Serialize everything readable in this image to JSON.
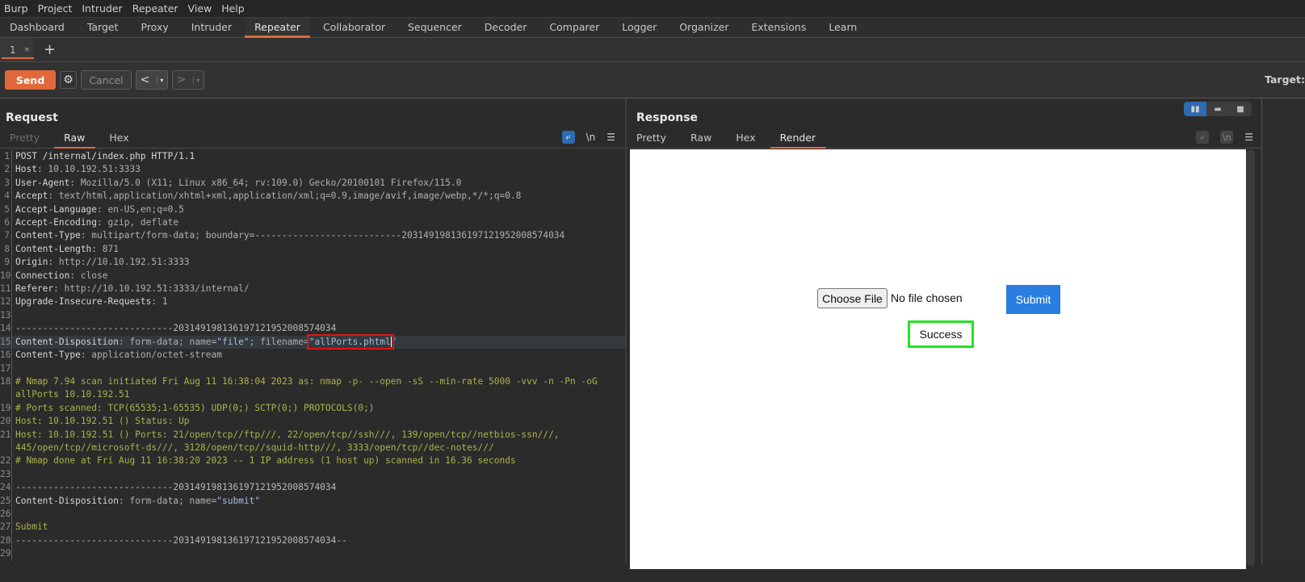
{
  "menubar": [
    "Burp",
    "Project",
    "Intruder",
    "Repeater",
    "View",
    "Help"
  ],
  "main_tabs": [
    {
      "label": "Dashboard"
    },
    {
      "label": "Target"
    },
    {
      "label": "Proxy"
    },
    {
      "label": "Intruder"
    },
    {
      "label": "Repeater",
      "active": true
    },
    {
      "label": "Collaborator"
    },
    {
      "label": "Sequencer"
    },
    {
      "label": "Decoder"
    },
    {
      "label": "Comparer"
    },
    {
      "label": "Logger"
    },
    {
      "label": "Organizer"
    },
    {
      "label": "Extensions"
    },
    {
      "label": "Learn"
    }
  ],
  "repeater_tab": {
    "label": "1",
    "close": "×",
    "add": "+"
  },
  "toolbar": {
    "send": "Send",
    "cancel": "Cancel",
    "prev": "<",
    "next": ">",
    "dropdown": "▾",
    "target_label": "Target:"
  },
  "request": {
    "title": "Request",
    "tabs": [
      "Pretty",
      "Raw",
      "Hex"
    ],
    "active_tab": "Raw",
    "tools": {
      "wrap": "wrap-icon",
      "newline": "\\n",
      "menu": "☰"
    },
    "lines": [
      {
        "n": "1",
        "parts": [
          [
            "code",
            "POST /internal/index.php HTTP/1.1"
          ]
        ]
      },
      {
        "n": "2",
        "parts": [
          [
            "hn",
            "Host"
          ],
          [
            "hv",
            ": 10.10.192.51:3333"
          ]
        ]
      },
      {
        "n": "3",
        "parts": [
          [
            "hn",
            "User-Agent"
          ],
          [
            "hv",
            ": Mozilla/5.0 (X11; Linux x86_64; rv:109.0) Gecko/20100101 Firefox/115.0"
          ]
        ]
      },
      {
        "n": "4",
        "parts": [
          [
            "hn",
            "Accept"
          ],
          [
            "hv",
            ": text/html,application/xhtml+xml,application/xml;q=0.9,image/avif,image/webp,*/*;q=0.8"
          ]
        ]
      },
      {
        "n": "5",
        "parts": [
          [
            "hn",
            "Accept-Language"
          ],
          [
            "hv",
            ": en-US,en;q=0.5"
          ]
        ]
      },
      {
        "n": "6",
        "parts": [
          [
            "hn",
            "Accept-Encoding"
          ],
          [
            "hv",
            ": gzip, deflate"
          ]
        ]
      },
      {
        "n": "7",
        "parts": [
          [
            "hn",
            "Content-Type"
          ],
          [
            "hv",
            ": multipart/form-data; boundary=---------------------------203149198136197121952008574034"
          ]
        ]
      },
      {
        "n": "8",
        "parts": [
          [
            "hn",
            "Content-Length"
          ],
          [
            "hv",
            ": 871"
          ]
        ]
      },
      {
        "n": "9",
        "parts": [
          [
            "hn",
            "Origin"
          ],
          [
            "hv",
            ": http://10.10.192.51:3333"
          ]
        ]
      },
      {
        "n": "10",
        "parts": [
          [
            "hn",
            "Connection"
          ],
          [
            "hv",
            ": close"
          ]
        ]
      },
      {
        "n": "11",
        "parts": [
          [
            "hn",
            "Referer"
          ],
          [
            "hv",
            ": http://10.10.192.51:3333/internal/"
          ]
        ]
      },
      {
        "n": "12",
        "parts": [
          [
            "hn",
            "Upgrade-Insecure-Requests"
          ],
          [
            "hv",
            ": 1"
          ]
        ]
      },
      {
        "n": "13",
        "parts": []
      },
      {
        "n": "14",
        "parts": [
          [
            "bd",
            "-----------------------------203149198136197121952008574034"
          ]
        ]
      },
      {
        "n": "15",
        "highlight": true,
        "parts": [
          [
            "hn",
            "Content-Disposition"
          ],
          [
            "hv",
            ": form-data; name="
          ],
          [
            "str",
            "\"file\""
          ],
          [
            "hv",
            "; filename="
          ],
          [
            "filename",
            "\"allPorts.phtml\""
          ]
        ]
      },
      {
        "n": "16",
        "parts": [
          [
            "hn",
            "Content-Type"
          ],
          [
            "hv",
            ": application/octet-stream"
          ]
        ]
      },
      {
        "n": "17",
        "parts": []
      },
      {
        "n": "18",
        "parts": [
          [
            "body",
            "# Nmap 7.94 scan initiated Fri Aug 11 16:38:04 2023 as: nmap -p- --open -sS --min-rate 5000 -vvv -n -Pn -oG"
          ]
        ]
      },
      {
        "n": "",
        "parts": [
          [
            "body",
            "allPorts 10.10.192.51"
          ]
        ]
      },
      {
        "n": "19",
        "parts": [
          [
            "body",
            "# Ports scanned: TCP(65535;1-65535) UDP(0;) SCTP(0;) PROTOCOLS(0;)"
          ]
        ]
      },
      {
        "n": "20",
        "parts": [
          [
            "body",
            "Host: 10.10.192.51 () Status: Up"
          ]
        ]
      },
      {
        "n": "21",
        "parts": [
          [
            "body",
            "Host: 10.10.192.51 () Ports: 21/open/tcp//ftp///, 22/open/tcp//ssh///, 139/open/tcp//netbios-ssn///,"
          ]
        ]
      },
      {
        "n": "",
        "parts": [
          [
            "body",
            "445/open/tcp//microsoft-ds///, 3128/open/tcp//squid-http///, 3333/open/tcp//dec-notes///"
          ]
        ]
      },
      {
        "n": "22",
        "parts": [
          [
            "body",
            "# Nmap done at Fri Aug 11 16:38:20 2023 -- 1 IP address (1 host up) scanned in 16.36 seconds"
          ]
        ]
      },
      {
        "n": "23",
        "parts": []
      },
      {
        "n": "24",
        "parts": [
          [
            "bd",
            "-----------------------------203149198136197121952008574034"
          ]
        ]
      },
      {
        "n": "25",
        "parts": [
          [
            "hn",
            "Content-Disposition"
          ],
          [
            "hv",
            ": form-data; name="
          ],
          [
            "str",
            "\"submit\""
          ]
        ]
      },
      {
        "n": "26",
        "parts": []
      },
      {
        "n": "27",
        "parts": [
          [
            "body",
            "Submit"
          ]
        ]
      },
      {
        "n": "28",
        "parts": [
          [
            "bd",
            "-----------------------------203149198136197121952008574034--"
          ]
        ]
      },
      {
        "n": "29",
        "parts": []
      }
    ]
  },
  "response": {
    "title": "Response",
    "tabs": [
      "Pretty",
      "Raw",
      "Hex",
      "Render"
    ],
    "active_tab": "Render",
    "tools": {
      "newline": "\\n",
      "menu": "☰"
    },
    "render": {
      "choose_file": "Choose File",
      "no_file": "No file chosen",
      "submit": "Submit",
      "message": "Success"
    }
  },
  "colors": {
    "accent": "#e0683a",
    "selected_blue": "#2f6bb0",
    "highlight_red": "#e01414",
    "success_green": "#22e322",
    "submit_blue": "#2a7ee0"
  }
}
